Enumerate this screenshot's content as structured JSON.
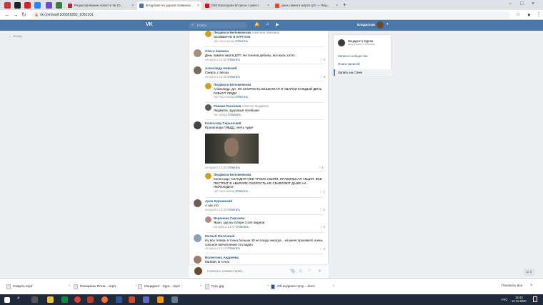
{
  "browser": {
    "tabs": [
      {
        "title": "Редактирование новости № 10..."
      },
      {
        "title": "В Кургане на дороге появилис..."
      },
      {
        "title": "(50) Ежегодная встреча с умест..."
      },
      {
        "title": "день памяти жертв дтп — Янд..."
      }
    ],
    "url": "vk.com/wall-106351883_1062101",
    "new_tab": "+"
  },
  "vk": {
    "logo": "VK",
    "search_placeholder": "Поиск",
    "user_name": "Владислав",
    "back_link": "Назад"
  },
  "comments": [
    {
      "name": "Людмила Беломенкова",
      "replied": "ответила Михаилу",
      "text": "ОСОБЕННО В КУРГАНЕ",
      "time": "три часа назад",
      "reply": "Ответить",
      "likes": ""
    },
    {
      "name": "Ольга Заикина",
      "text": "День памяти жертв ДТП. Не поняли дебилы, все жить хотят...",
      "time": "сегодня в 14:05",
      "reply": "Ответить",
      "likes": "4"
    },
    {
      "name": "Александр Новский",
      "text": "Смерть с весны",
      "time": "сегодня в 13:32",
      "reply": "Ответить",
      "likes": "3"
    },
    {
      "name": "Людмила Беломенкова",
      "text": "Александр, ДА. ИХ СКОРОСТЬ БЕШЕННАЯ И АВАРИИ КАЖДЫЙ ДЕНЬ ГИБНУТ ЛЮДИ",
      "time": "три часа назад",
      "reply": "Ответить",
      "likes": ""
    },
    {
      "name": "Рамзан Расковов",
      "replied": "ответил Людмиле",
      "text": "Людмила, здоровые погибшие",
      "time": "час назад",
      "reply": "Ответить",
      "likes": ""
    },
    {
      "name": "Колесскар Серьезский",
      "text": "Пропаганда ГИБДД, опять чудит",
      "time": "сегодня в 13:05",
      "reply": "Ответить",
      "likes": "1"
    },
    {
      "name": "Людмила Беломенкова",
      "text": "Колесскар, СЕГОДНЯ УЖЕ ТРОИХ СБИЛИ, ПРАВИЛЬНАЯ АКЦИЯ. ВСЕ ПЕСТРИТ В АВАРИЯХ СКОРОСТЬ НЕ СБАВЛЯЮТ ДАЖЕ НА ПЕРЕХОДАХ.",
      "time": "три часа назад",
      "reply": "Ответить",
      "likes": "1"
    },
    {
      "name": "Арон Курганский",
      "text": "А где это",
      "time": "сегодня в 13:40",
      "reply": "Ответить",
      "likes": "1"
    },
    {
      "name": "Вероника Сергеева",
      "text": "Ярон, эда на потерн стоят видели",
      "time": "сегодня в 14:07",
      "reply": "Ответить",
      "likes": "2"
    },
    {
      "name": "Матвей Железный",
      "text": "Ну все теперь в точно больше 40 не поеду никогда... на меня произвело очень сильное впечатление это видео",
      "time": "сегодня в 14:16",
      "reply": "Ответить",
      "likes": "3"
    },
    {
      "name": "Валентина Андреева",
      "text": "Матвей, В точно",
      "time": "",
      "reply": "",
      "likes": ""
    }
  ],
  "composer": {
    "placeholder": "Написать комментарий..."
  },
  "sidebar": {
    "group_name": "Инцидент | Курган",
    "group_sub": "вернуться к странице",
    "items": [
      "Записи сообщества",
      "Поиск записей",
      "Запись на стене"
    ]
  },
  "downloads": {
    "items": [
      "Смерть.mp4",
      "Похороны Поли....mp4",
      "Инцидент - Кург....mp4",
      "Гусь.jpg",
      "Об индексе потр....docx"
    ],
    "show_all": "Показать все"
  },
  "taskbar": {
    "lang": "РУС",
    "time": "18:43",
    "date": "12.11.2020"
  },
  "pager": "1/ 2"
}
